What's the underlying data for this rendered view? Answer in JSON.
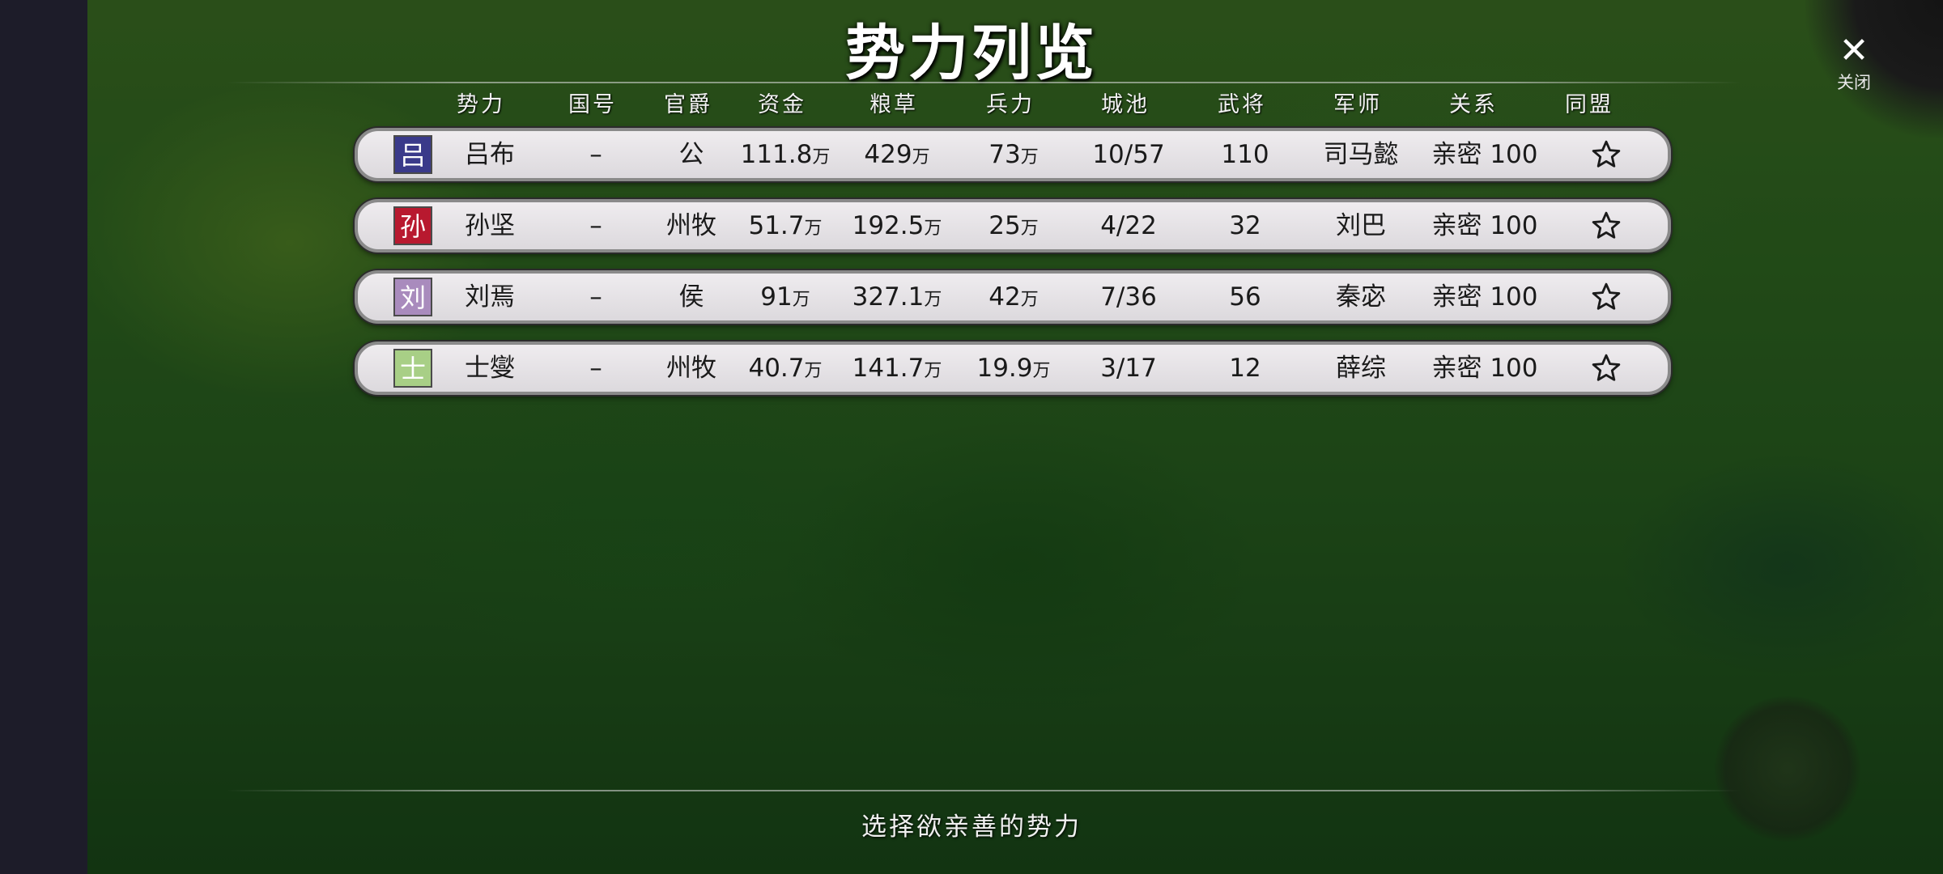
{
  "title": "势力列览",
  "close": {
    "icon": "close-icon",
    "label": "关闭"
  },
  "headers": [
    "势力",
    "国号",
    "官爵",
    "资金",
    "粮草",
    "兵力",
    "城池",
    "武将",
    "军师",
    "关系",
    "同盟"
  ],
  "unit": "万",
  "colors": {
    "吕": "#3a3a8a",
    "孙": "#b8192f",
    "刘": "#a98bbd",
    "士": "#a8cf86"
  },
  "rows": [
    {
      "emblem": "吕",
      "emblem_color": "#3a3a8a",
      "leader": "吕布",
      "country": "–",
      "title": "公",
      "gold": "111.8",
      "food": "429",
      "troops": "73",
      "cities": "10/57",
      "officers": "110",
      "strategist": "司马懿",
      "relation": "亲密 100",
      "ally_icon": "star-outline-icon"
    },
    {
      "emblem": "孙",
      "emblem_color": "#b8192f",
      "leader": "孙坚",
      "country": "–",
      "title": "州牧",
      "gold": "51.7",
      "food": "192.5",
      "troops": "25",
      "cities": "4/22",
      "officers": "32",
      "strategist": "刘巴",
      "relation": "亲密 100",
      "ally_icon": "star-outline-icon"
    },
    {
      "emblem": "刘",
      "emblem_color": "#a98bbd",
      "leader": "刘焉",
      "country": "–",
      "title": "侯",
      "gold": "91",
      "food": "327.1",
      "troops": "42",
      "cities": "7/36",
      "officers": "56",
      "strategist": "秦宓",
      "relation": "亲密 100",
      "ally_icon": "star-outline-icon"
    },
    {
      "emblem": "士",
      "emblem_color": "#a8cf86",
      "leader": "士燮",
      "country": "–",
      "title": "州牧",
      "gold": "40.7",
      "food": "141.7",
      "troops": "19.9",
      "cities": "3/17",
      "officers": "12",
      "strategist": "薛综",
      "relation": "亲密 100",
      "ally_icon": "star-outline-icon"
    }
  ],
  "footer": "选择欲亲善的势力"
}
